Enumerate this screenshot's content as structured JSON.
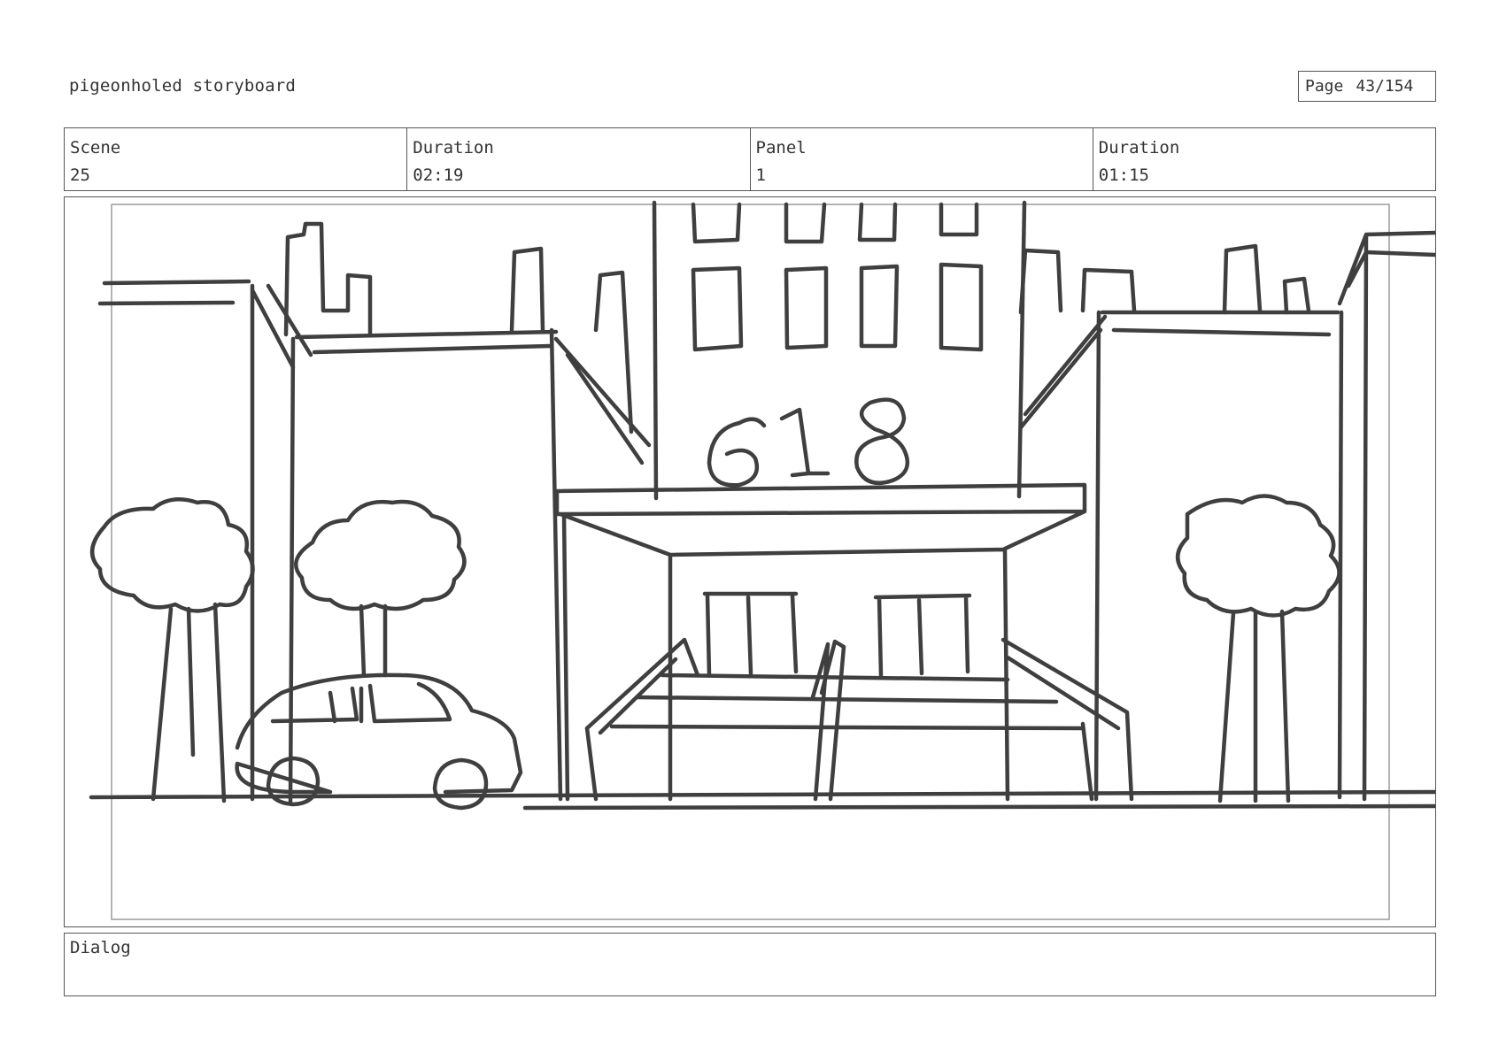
{
  "header": {
    "title": "pigeonholed storyboard",
    "page_label": "Page",
    "page_number": "43/154"
  },
  "info": {
    "scene_label": "Scene",
    "scene_value": "25",
    "scene_duration_label": "Duration",
    "scene_duration_value": "02:19",
    "panel_label": "Panel",
    "panel_value": "1",
    "panel_duration_label": "Duration",
    "panel_duration_value": "01:15"
  },
  "sketch": {
    "building_number": "618",
    "line_color": "#3f3f3f",
    "safe_frame_color": "#9a9a9a"
  },
  "dialog": {
    "label": "Dialog",
    "text": ""
  }
}
